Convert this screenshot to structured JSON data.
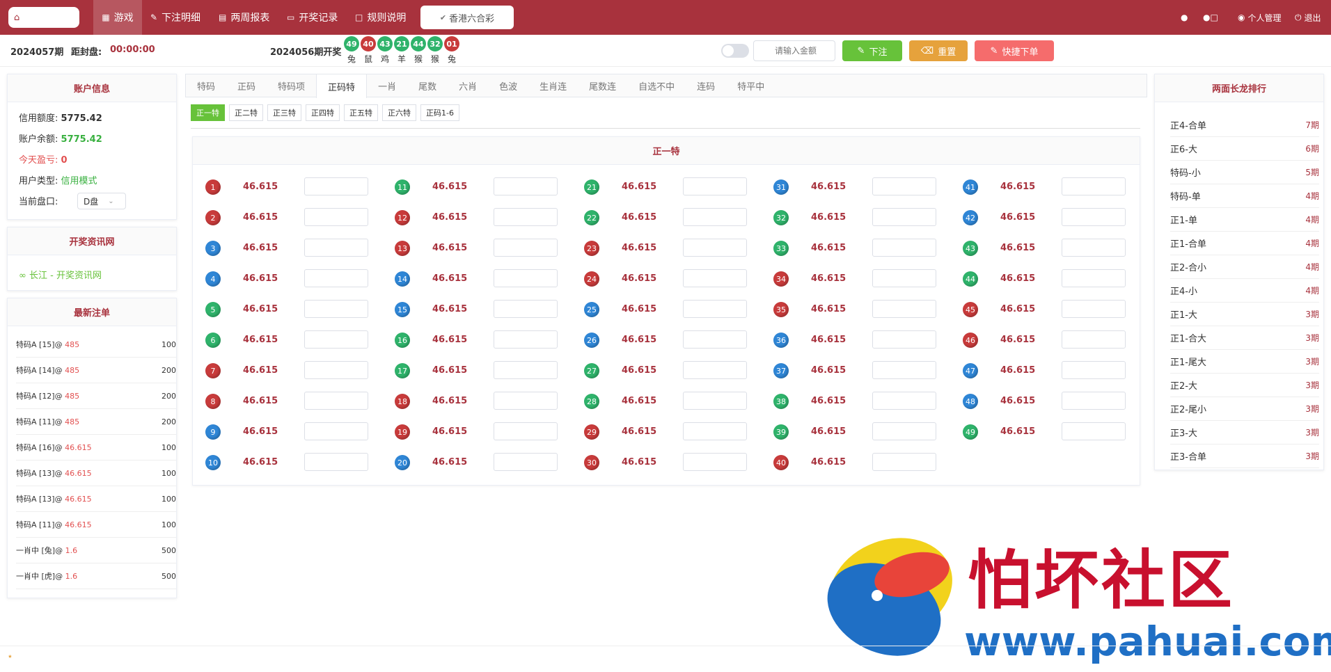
{
  "nav": {
    "home_icon": "home-icon",
    "items": [
      {
        "label": "游戏",
        "icon": "grid-icon"
      },
      {
        "label": "下注明细",
        "icon": "edit-icon"
      },
      {
        "label": "两周报表",
        "icon": "calendar-icon"
      },
      {
        "label": "开奖记录",
        "icon": "monitor-icon"
      },
      {
        "label": "规则说明",
        "icon": "chat-icon"
      }
    ],
    "game_select": "香港六合彩",
    "right": [
      {
        "label": "",
        "icon": "user-icon"
      },
      {
        "label": "",
        "icon": "users-lock-icon"
      },
      {
        "label": "个人管理",
        "icon": "globe-icon"
      },
      {
        "label": "退出",
        "icon": "power-icon"
      }
    ]
  },
  "info": {
    "period": "2024057期",
    "close_label": "距封盘:",
    "countdown": "00:00:00",
    "last_draw": "2024056期开奖",
    "draw_balls": [
      {
        "n": "49",
        "z": "兔",
        "c": "#2fb36b"
      },
      {
        "n": "40",
        "z": "鼠",
        "c": "#c83b3b"
      },
      {
        "n": "43",
        "z": "鸡",
        "c": "#2fb36b"
      },
      {
        "n": "21",
        "z": "羊",
        "c": "#2fb36b"
      },
      {
        "n": "44",
        "z": "猴",
        "c": "#2fb36b"
      },
      {
        "n": "32",
        "z": "猴",
        "c": "#2fb36b"
      },
      {
        "n": "01",
        "z": "兔",
        "c": "#c83b3b"
      }
    ],
    "amount_placeholder": "请输入金额",
    "bet_button": "下注",
    "reset_button": "重置",
    "quick_button": "快捷下单"
  },
  "account": {
    "title": "账户信息",
    "credit_label": "信用额度:",
    "credit": "5775.42",
    "balance_label": "账户余额:",
    "balance": "5775.42",
    "profit_label": "今天盈亏:",
    "profit": "0",
    "type_label": "用户类型:",
    "type": "信用模式",
    "pan_label": "当前盘口:",
    "pan": "D盘"
  },
  "kaijiang": {
    "title": "开奖资讯网",
    "link": "长江 - 开奖资讯网"
  },
  "latest": {
    "title": "最新注单",
    "rows": [
      {
        "name": "特码A [15]@",
        "odds": "485",
        "amount": "100"
      },
      {
        "name": "特码A [14]@",
        "odds": "485",
        "amount": "200"
      },
      {
        "name": "特码A [12]@",
        "odds": "485",
        "amount": "200"
      },
      {
        "name": "特码A [11]@",
        "odds": "485",
        "amount": "200"
      },
      {
        "name": "特码A [16]@",
        "odds": "46.615",
        "amount": "100"
      },
      {
        "name": "特码A [13]@",
        "odds": "46.615",
        "amount": "100"
      },
      {
        "name": "特码A [13]@",
        "odds": "46.615",
        "amount": "100"
      },
      {
        "name": "特码A [11]@",
        "odds": "46.615",
        "amount": "100"
      },
      {
        "name": "一肖中 [兔]@",
        "odds": "1.6",
        "amount": "500"
      },
      {
        "name": "一肖中 [虎]@",
        "odds": "1.6",
        "amount": "500"
      }
    ]
  },
  "tabs": [
    "特码",
    "正码",
    "特码项",
    "正码特",
    "一肖",
    "尾数",
    "六肖",
    "色波",
    "生肖连",
    "尾数连",
    "自选不中",
    "连码",
    "特平中"
  ],
  "active_tab": 3,
  "subtabs": [
    "正一特",
    "正二特",
    "正三特",
    "正四特",
    "正五特",
    "正六特",
    "正码1-6"
  ],
  "active_subtab": 0,
  "grid": {
    "title": "正一特",
    "odds": "46.615",
    "balls": [
      {
        "n": "1",
        "c": "#c83b3b"
      },
      {
        "n": "2",
        "c": "#c83b3b"
      },
      {
        "n": "3",
        "c": "#2f86d6"
      },
      {
        "n": "4",
        "c": "#2f86d6"
      },
      {
        "n": "5",
        "c": "#2fb36b"
      },
      {
        "n": "6",
        "c": "#2fb36b"
      },
      {
        "n": "7",
        "c": "#c83b3b"
      },
      {
        "n": "8",
        "c": "#c83b3b"
      },
      {
        "n": "9",
        "c": "#2f86d6"
      },
      {
        "n": "10",
        "c": "#2f86d6"
      },
      {
        "n": "11",
        "c": "#2fb36b"
      },
      {
        "n": "12",
        "c": "#c83b3b"
      },
      {
        "n": "13",
        "c": "#c83b3b"
      },
      {
        "n": "14",
        "c": "#2f86d6"
      },
      {
        "n": "15",
        "c": "#2f86d6"
      },
      {
        "n": "16",
        "c": "#2fb36b"
      },
      {
        "n": "17",
        "c": "#2fb36b"
      },
      {
        "n": "18",
        "c": "#c83b3b"
      },
      {
        "n": "19",
        "c": "#c83b3b"
      },
      {
        "n": "20",
        "c": "#2f86d6"
      },
      {
        "n": "21",
        "c": "#2fb36b"
      },
      {
        "n": "22",
        "c": "#2fb36b"
      },
      {
        "n": "23",
        "c": "#c83b3b"
      },
      {
        "n": "24",
        "c": "#c83b3b"
      },
      {
        "n": "25",
        "c": "#2f86d6"
      },
      {
        "n": "26",
        "c": "#2f86d6"
      },
      {
        "n": "27",
        "c": "#2fb36b"
      },
      {
        "n": "28",
        "c": "#2fb36b"
      },
      {
        "n": "29",
        "c": "#c83b3b"
      },
      {
        "n": "30",
        "c": "#c83b3b"
      },
      {
        "n": "31",
        "c": "#2f86d6"
      },
      {
        "n": "32",
        "c": "#2fb36b"
      },
      {
        "n": "33",
        "c": "#2fb36b"
      },
      {
        "n": "34",
        "c": "#c83b3b"
      },
      {
        "n": "35",
        "c": "#c83b3b"
      },
      {
        "n": "36",
        "c": "#2f86d6"
      },
      {
        "n": "37",
        "c": "#2f86d6"
      },
      {
        "n": "38",
        "c": "#2fb36b"
      },
      {
        "n": "39",
        "c": "#2fb36b"
      },
      {
        "n": "40",
        "c": "#c83b3b"
      },
      {
        "n": "41",
        "c": "#2f86d6"
      },
      {
        "n": "42",
        "c": "#2f86d6"
      },
      {
        "n": "43",
        "c": "#2fb36b"
      },
      {
        "n": "44",
        "c": "#2fb36b"
      },
      {
        "n": "45",
        "c": "#c83b3b"
      },
      {
        "n": "46",
        "c": "#c83b3b"
      },
      {
        "n": "47",
        "c": "#2f86d6"
      },
      {
        "n": "48",
        "c": "#2f86d6"
      },
      {
        "n": "49",
        "c": "#2fb36b"
      }
    ]
  },
  "ranking": {
    "title": "两面长龙排行",
    "rows": [
      {
        "name": "正4-合单",
        "p": "7期"
      },
      {
        "name": "正6-大",
        "p": "6期"
      },
      {
        "name": "特码-小",
        "p": "5期"
      },
      {
        "name": "特码-单",
        "p": "4期"
      },
      {
        "name": "正1-单",
        "p": "4期"
      },
      {
        "name": "正1-合单",
        "p": "4期"
      },
      {
        "name": "正2-合小",
        "p": "4期"
      },
      {
        "name": "正4-小",
        "p": "4期"
      },
      {
        "name": "正1-大",
        "p": "3期"
      },
      {
        "name": "正1-合大",
        "p": "3期"
      },
      {
        "name": "正1-尾大",
        "p": "3期"
      },
      {
        "name": "正2-大",
        "p": "3期"
      },
      {
        "name": "正2-尾小",
        "p": "3期"
      },
      {
        "name": "正3-大",
        "p": "3期"
      },
      {
        "name": "正3-合单",
        "p": "3期"
      }
    ]
  },
  "watermark": {
    "text": "怕坏社区",
    "url": "www.pahuai.com"
  },
  "colors": {
    "brand": "#a8323d",
    "green": "#67c23a",
    "orange": "#e6a23c",
    "pink": "#f56c6c",
    "red_ball": "#c83b3b",
    "blue_ball": "#2f86d6",
    "green_ball": "#2fb36b"
  }
}
